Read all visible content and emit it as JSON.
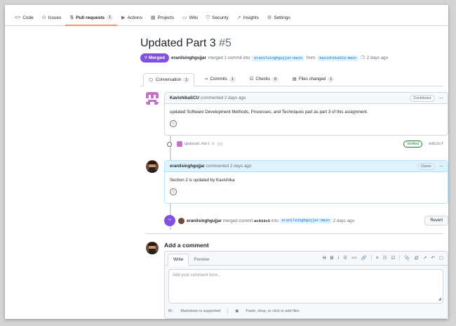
{
  "nav": {
    "items": [
      {
        "icon": "<>",
        "label": "Code"
      },
      {
        "icon": "⊙",
        "label": "Issues"
      },
      {
        "icon": "⇅",
        "label": "Pull requests",
        "count": "1"
      },
      {
        "icon": "▶",
        "label": "Actions"
      },
      {
        "icon": "▦",
        "label": "Projects"
      },
      {
        "icon": "▭",
        "label": "Wiki"
      },
      {
        "icon": "⛉",
        "label": "Security"
      },
      {
        "icon": "↗",
        "label": "Insights"
      },
      {
        "icon": "⚙",
        "label": "Settings"
      }
    ]
  },
  "pr": {
    "title": "Updated Part 3",
    "number": "#5",
    "status": "Merged",
    "author": "eranilsinghgujjar",
    "merged_text": "merged 1 commit into",
    "base_branch": "eranilsinghgujjar:main",
    "from_text": "from",
    "head_branch": "kavishikaSCU:main",
    "time": "2 days ago"
  },
  "tabs": [
    {
      "label": "Conversation",
      "count": "1"
    },
    {
      "label": "Commits",
      "count": "1"
    },
    {
      "label": "Checks",
      "count": "0"
    },
    {
      "label": "Files changed",
      "count": "1"
    }
  ],
  "comments": [
    {
      "author": "KavishikaSCU",
      "meta": "commented 2 days ago",
      "role": "Contributor",
      "body": "updated Software Development Methods, Processes, and Techniques part as part 3 of this assignment."
    },
    {
      "author": "eranilsinghgujjar",
      "meta": "commented 2 days ago",
      "role": "Owner",
      "body": "Section 2 is updated by Kavishika"
    }
  ],
  "commit": {
    "message": "Updated Part 3",
    "more": "···",
    "verified": "Verified",
    "sha": "9d5c5cf"
  },
  "merge_event": {
    "author": "eranilsinghgujjar",
    "text": "merged commit",
    "sha": "ac833c5",
    "into": "into",
    "branch": "eranilsinghgujjar:main",
    "time": "2 days ago",
    "revert_label": "Revert"
  },
  "add_comment": {
    "title": "Add a comment",
    "tabs": [
      "Write",
      "Preview"
    ],
    "placeholder": "Add your comment here...",
    "markdown_note": "Markdown is supported",
    "attach_note": "Paste, drop, or click to add files"
  },
  "colors": {
    "merged": "#8250df",
    "accent": "#0969da",
    "nav_underline": "#fd8c73"
  }
}
